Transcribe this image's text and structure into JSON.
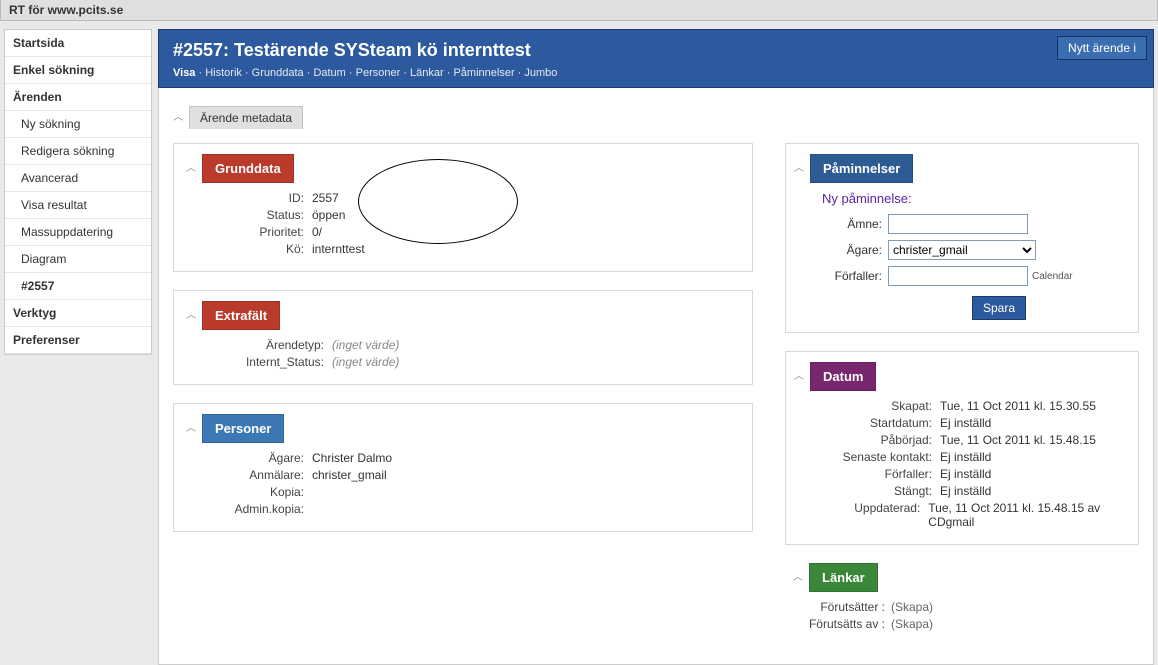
{
  "app_title": "RT för www.pcits.se",
  "sidebar": {
    "items": [
      {
        "label": "Startsida",
        "section": true
      },
      {
        "label": "Enkel sökning",
        "section": true
      },
      {
        "label": "Ärenden",
        "section": true
      },
      {
        "label": "Ny sökning",
        "sub": true
      },
      {
        "label": "Redigera sökning",
        "sub": true
      },
      {
        "label": "Avancerad",
        "sub": true
      },
      {
        "label": "Visa resultat",
        "sub": true
      },
      {
        "label": "Massuppdatering",
        "sub": true
      },
      {
        "label": "Diagram",
        "sub": true
      },
      {
        "label": "#2557",
        "sub": true,
        "bold": true
      },
      {
        "label": "Verktyg",
        "section": true
      },
      {
        "label": "Preferenser",
        "section": true
      }
    ]
  },
  "header": {
    "title": "#2557: Testärende SYSteam kö internttest",
    "tabs_label_visa": "Visa",
    "tabs": [
      "Historik",
      "Grunddata",
      "Datum",
      "Personer",
      "Länkar",
      "Påminnelser",
      "Jumbo"
    ],
    "new_ticket_btn": "Nytt ärende i"
  },
  "outer_title": "Ärende metadata",
  "grunddata": {
    "title": "Grunddata",
    "rows": [
      {
        "label": "ID:",
        "value": "2557"
      },
      {
        "label": "Status:",
        "value": "öppen"
      },
      {
        "label": "Prioritet:",
        "value": "0/"
      },
      {
        "label": "Kö:",
        "value": "internttest"
      }
    ]
  },
  "extrafalt": {
    "title": "Extrafält",
    "rows": [
      {
        "label": "Ärendetyp:",
        "value": "(inget värde)",
        "noval": true
      },
      {
        "label": "Internt_Status:",
        "value": "(inget värde)",
        "noval": true
      }
    ]
  },
  "personer": {
    "title": "Personer",
    "rows": [
      {
        "label": "Ägare:",
        "value": "Christer Dalmo"
      },
      {
        "label": "Anmälare:",
        "value": "christer_gmail"
      },
      {
        "label": "Kopia:",
        "value": ""
      },
      {
        "label": "Admin.kopia:",
        "value": ""
      }
    ]
  },
  "paminnelser": {
    "title": "Påminnelser",
    "new_label": "Ny påminnelse:",
    "subject_label": "Ämne:",
    "owner_label": "Ägare:",
    "owner_value": "christer_gmail",
    "due_label": "Förfaller:",
    "calendar_label": "Calendar",
    "save_btn": "Spara"
  },
  "datum": {
    "title": "Datum",
    "rows": [
      {
        "label": "Skapat:",
        "value": "Tue, 11 Oct 2011 kl. 15.30.55"
      },
      {
        "label": "Startdatum:",
        "value": "Ej inställd"
      },
      {
        "label": "Påbörjad:",
        "value": "Tue, 11 Oct 2011 kl. 15.48.15"
      },
      {
        "label": "Senaste kontakt:",
        "value": "Ej inställd"
      },
      {
        "label": "Förfaller:",
        "value": "Ej inställd"
      },
      {
        "label": "Stängt:",
        "value": "Ej inställd"
      },
      {
        "label": "Uppdaterad:",
        "value": "Tue, 11 Oct 2011 kl. 15.48.15 av CDgmail"
      }
    ]
  },
  "lankar": {
    "title": "Länkar",
    "rows": [
      {
        "label": "Förutsätter :",
        "create": "(Skapa)"
      },
      {
        "label": "Förutsätts av :",
        "create": "(Skapa)"
      }
    ]
  }
}
